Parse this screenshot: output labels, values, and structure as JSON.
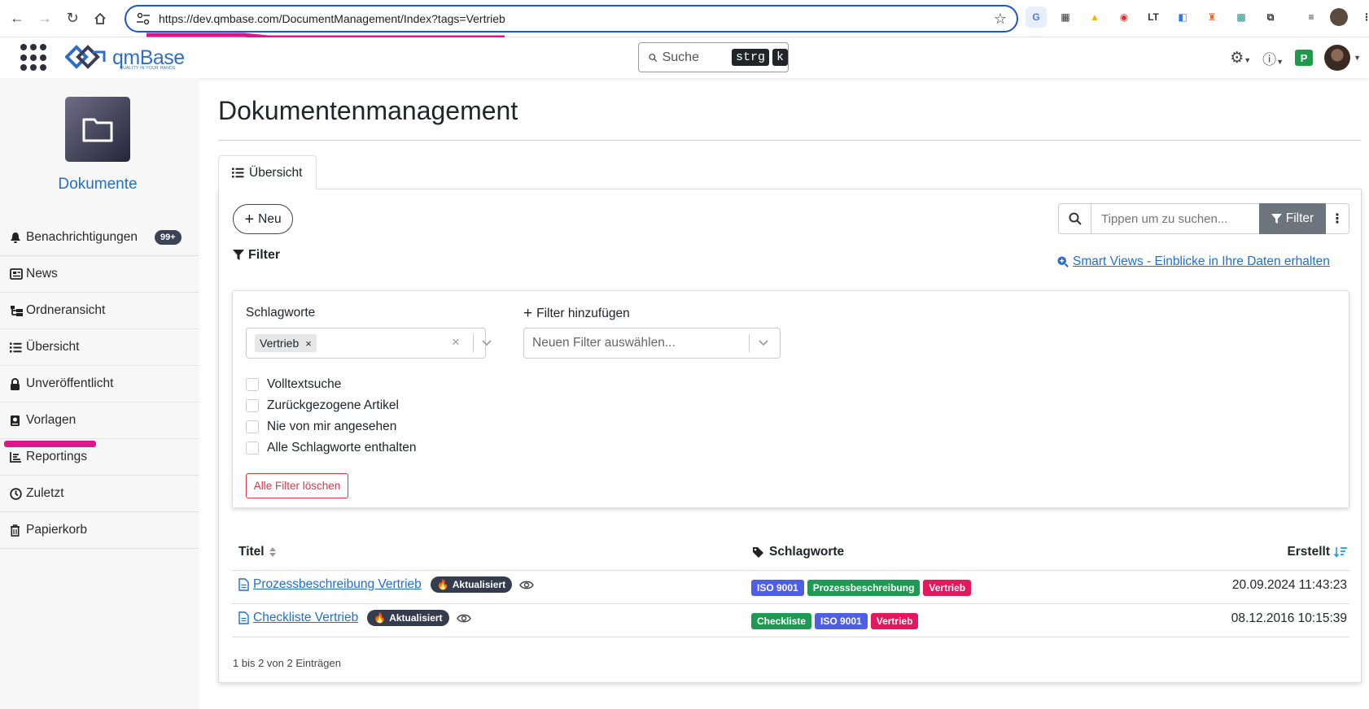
{
  "browser": {
    "url": "https://dev.qmbase.com/DocumentManagement/Index?tags=Vertrieb"
  },
  "header": {
    "brand": "qmBase",
    "tagline": "QUALITY IN YOUR HANDS",
    "search_placeholder": "Suche",
    "shortcut_key1": "strg",
    "shortcut_key2": "k",
    "profile_badge": "P"
  },
  "sidebar": {
    "title": "Dokumente",
    "items": [
      {
        "label": "Benachrichtigungen",
        "icon": "bell-icon",
        "badge": "99+"
      },
      {
        "label": "News",
        "icon": "newspaper-icon"
      },
      {
        "label": "Ordneransicht",
        "icon": "folder-tree-icon"
      },
      {
        "label": "Übersicht",
        "icon": "list-icon"
      },
      {
        "label": "Unveröffentlicht",
        "icon": "lock-icon"
      },
      {
        "label": "Vorlagen",
        "icon": "template-book-icon"
      },
      {
        "label": "Reportings",
        "icon": "chart-icon"
      },
      {
        "label": "Zuletzt",
        "icon": "clock-icon"
      },
      {
        "label": "Papierkorb",
        "icon": "trash-icon"
      }
    ]
  },
  "main": {
    "title": "Dokumentenmanagement",
    "tab": "Übersicht",
    "new_button": "Neu",
    "filter_heading": "Filter",
    "search_placeholder": "Tippen um zu suchen...",
    "filter_button": "Filter",
    "smart_views_link": "Smart Views - Einblicke in Ihre Daten erhalten",
    "filter_panel": {
      "tags_label": "Schlagworte",
      "selected_tag": "Vertrieb",
      "add_filter_label": "Filter hinzufügen",
      "add_filter_placeholder": "Neuen Filter auswählen...",
      "checkboxes": [
        "Volltextsuche",
        "Zurückgezogene Artikel",
        "Nie von mir angesehen",
        "Alle Schlagworte enthalten"
      ],
      "clear_button": "Alle Filter löschen"
    },
    "table": {
      "col_title": "Titel",
      "col_tags": "Schlagworte",
      "col_created": "Erstellt",
      "rows": [
        {
          "title": "Prozessbeschreibung Vertrieb",
          "status": "Aktualisiert",
          "tags": [
            {
              "label": "ISO 9001",
              "color": "#4e5fe6"
            },
            {
              "label": "Prozessbeschreibung",
              "color": "#1e9a55"
            },
            {
              "label": "Vertrieb",
              "color": "#e3195d"
            }
          ],
          "created": "20.09.2024 11:43:23"
        },
        {
          "title": "Checkliste Vertrieb",
          "status": "Aktualisiert",
          "tags": [
            {
              "label": "Checkliste",
              "color": "#1e9a55"
            },
            {
              "label": "ISO 9001",
              "color": "#4e5fe6"
            },
            {
              "label": "Vertrieb",
              "color": "#e3195d"
            }
          ],
          "created": "08.12.2016 10:15:39"
        }
      ],
      "info": "1 bis 2 von 2 Einträgen"
    }
  },
  "colors": {
    "accent": "#1d6fd1",
    "annotation": "#e0148c"
  }
}
